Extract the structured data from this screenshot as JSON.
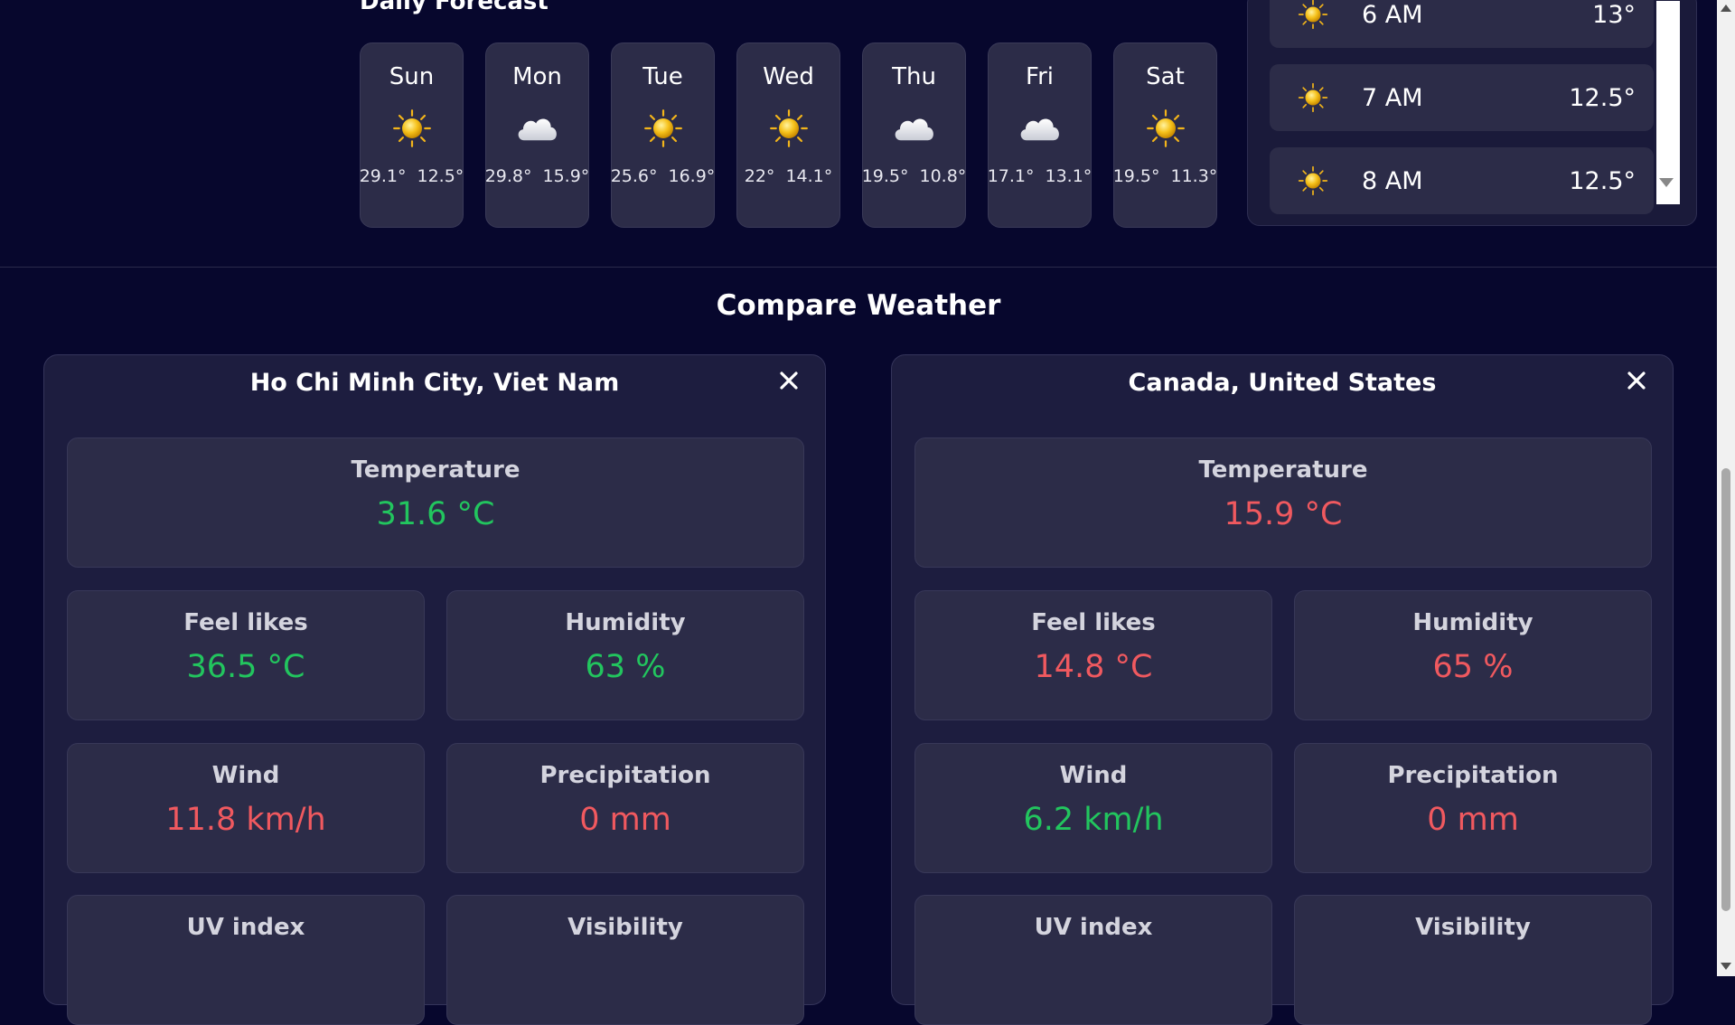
{
  "daily_forecast": {
    "title": "Daily Forecast",
    "days": [
      {
        "name": "Sun",
        "icon": "sun-icon",
        "high": "29.1°",
        "low": "12.5°"
      },
      {
        "name": "Mon",
        "icon": "cloud-icon",
        "high": "29.8°",
        "low": "15.9°"
      },
      {
        "name": "Tue",
        "icon": "sun-icon",
        "high": "25.6°",
        "low": "16.9°"
      },
      {
        "name": "Wed",
        "icon": "sun-icon",
        "high": "22°",
        "low": "14.1°"
      },
      {
        "name": "Thu",
        "icon": "cloud-icon",
        "high": "19.5°",
        "low": "10.8°"
      },
      {
        "name": "Fri",
        "icon": "cloud-icon",
        "high": "17.1°",
        "low": "13.1°"
      },
      {
        "name": "Sat",
        "icon": "sun-icon",
        "high": "19.5°",
        "low": "11.3°"
      }
    ]
  },
  "hourly": [
    {
      "time": "6 AM",
      "temp": "13°",
      "icon": "sun-icon"
    },
    {
      "time": "7 AM",
      "temp": "12.5°",
      "icon": "sun-icon"
    },
    {
      "time": "8 AM",
      "temp": "12.5°",
      "icon": "sun-icon"
    }
  ],
  "compare": {
    "title": "Compare Weather",
    "cities": [
      {
        "name": "Ho Chi Minh City, Viet Nam",
        "temperature": {
          "label": "Temperature",
          "value": "31.6 °C",
          "status": "green"
        },
        "feel_likes": {
          "label": "Feel likes",
          "value": "36.5 °C",
          "status": "green"
        },
        "humidity": {
          "label": "Humidity",
          "value": "63 %",
          "status": "green"
        },
        "wind": {
          "label": "Wind",
          "value": "11.8 km/h",
          "status": "red"
        },
        "precipitation": {
          "label": "Precipitation",
          "value": "0 mm",
          "status": "red"
        },
        "uv_index": {
          "label": "UV index",
          "value": "",
          "status": "red"
        },
        "visibility": {
          "label": "Visibility",
          "value": "",
          "status": "red"
        }
      },
      {
        "name": "Canada, United States",
        "temperature": {
          "label": "Temperature",
          "value": "15.9 °C",
          "status": "red"
        },
        "feel_likes": {
          "label": "Feel likes",
          "value": "14.8 °C",
          "status": "red"
        },
        "humidity": {
          "label": "Humidity",
          "value": "65 %",
          "status": "red"
        },
        "wind": {
          "label": "Wind",
          "value": "6.2 km/h",
          "status": "green"
        },
        "precipitation": {
          "label": "Precipitation",
          "value": "0 mm",
          "status": "red"
        },
        "uv_index": {
          "label": "UV index",
          "value": "",
          "status": "green"
        },
        "visibility": {
          "label": "Visibility",
          "value": "",
          "status": "green"
        }
      }
    ]
  },
  "colors": {
    "background": "#07072d",
    "card": "#2c2c48",
    "better": "#22c55e",
    "worse": "#f0595f"
  }
}
